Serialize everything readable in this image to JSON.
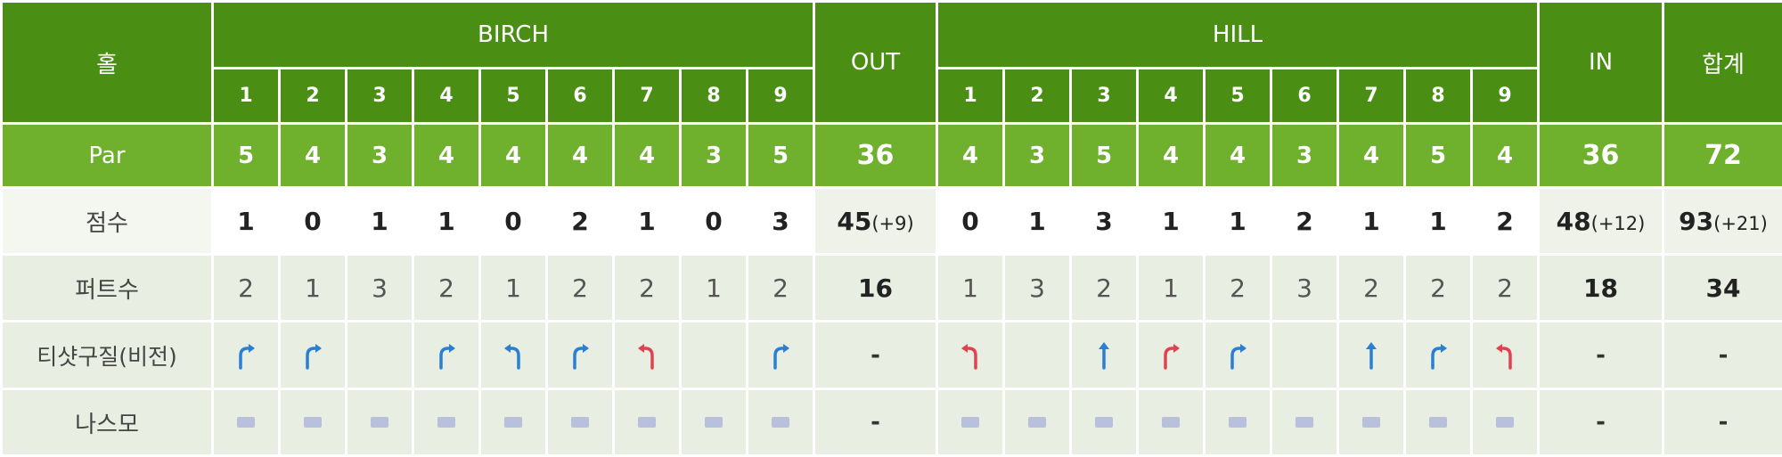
{
  "colors": {
    "header_green": "#4a8f14",
    "par_green": "#6fb02c",
    "arrow_blue": "#2a7fd4",
    "arrow_red": "#e0424f",
    "row_bg": "#e9eee2"
  },
  "header": {
    "hole_label": "홀",
    "course1": "BIRCH",
    "out_label": "OUT",
    "course2": "HILL",
    "in_label": "IN",
    "total_label": "합계",
    "holes1": [
      "1",
      "2",
      "3",
      "4",
      "5",
      "6",
      "7",
      "8",
      "9"
    ],
    "holes2": [
      "1",
      "2",
      "3",
      "4",
      "5",
      "6",
      "7",
      "8",
      "9"
    ]
  },
  "par": {
    "label": "Par",
    "course1": [
      "5",
      "4",
      "3",
      "4",
      "4",
      "4",
      "4",
      "3",
      "5"
    ],
    "out": "36",
    "course2": [
      "4",
      "3",
      "5",
      "4",
      "4",
      "3",
      "4",
      "5",
      "4"
    ],
    "in": "36",
    "total": "72"
  },
  "score": {
    "label": "점수",
    "course1": [
      "1",
      "0",
      "1",
      "1",
      "0",
      "2",
      "1",
      "0",
      "3"
    ],
    "out_value": "45",
    "out_diff": "(+9)",
    "course2": [
      "0",
      "1",
      "3",
      "1",
      "1",
      "2",
      "1",
      "1",
      "2"
    ],
    "in_value": "48",
    "in_diff": "(+12)",
    "total_value": "93",
    "total_diff": "(+21)"
  },
  "putts": {
    "label": "퍼트수",
    "course1": [
      "2",
      "1",
      "3",
      "2",
      "1",
      "2",
      "2",
      "1",
      "2"
    ],
    "out": "16",
    "course2": [
      "1",
      "3",
      "2",
      "1",
      "2",
      "3",
      "2",
      "2",
      "2"
    ],
    "in": "18",
    "total": "34"
  },
  "tee_shot": {
    "label": "티샷구질(비전)",
    "course1": [
      "right-blue",
      "right-blue",
      "",
      "right-blue",
      "left-blue",
      "right-blue",
      "left-red",
      "",
      "right-blue"
    ],
    "out": "-",
    "course2": [
      "left-red",
      "",
      "up-blue",
      "right-red",
      "right-blue",
      "",
      "up-blue",
      "right-blue",
      "left-red"
    ],
    "in": "-",
    "total": "-"
  },
  "nasmo": {
    "label": "나스모",
    "course1": [
      "video-icon",
      "video-icon",
      "video-icon",
      "video-icon",
      "video-icon",
      "video-icon",
      "video-icon",
      "video-icon",
      "video-icon"
    ],
    "out": "-",
    "course2": [
      "video-icon",
      "video-icon",
      "video-icon",
      "video-icon",
      "video-icon",
      "video-icon",
      "video-icon",
      "video-icon",
      "video-icon"
    ],
    "in": "-",
    "total": "-"
  }
}
